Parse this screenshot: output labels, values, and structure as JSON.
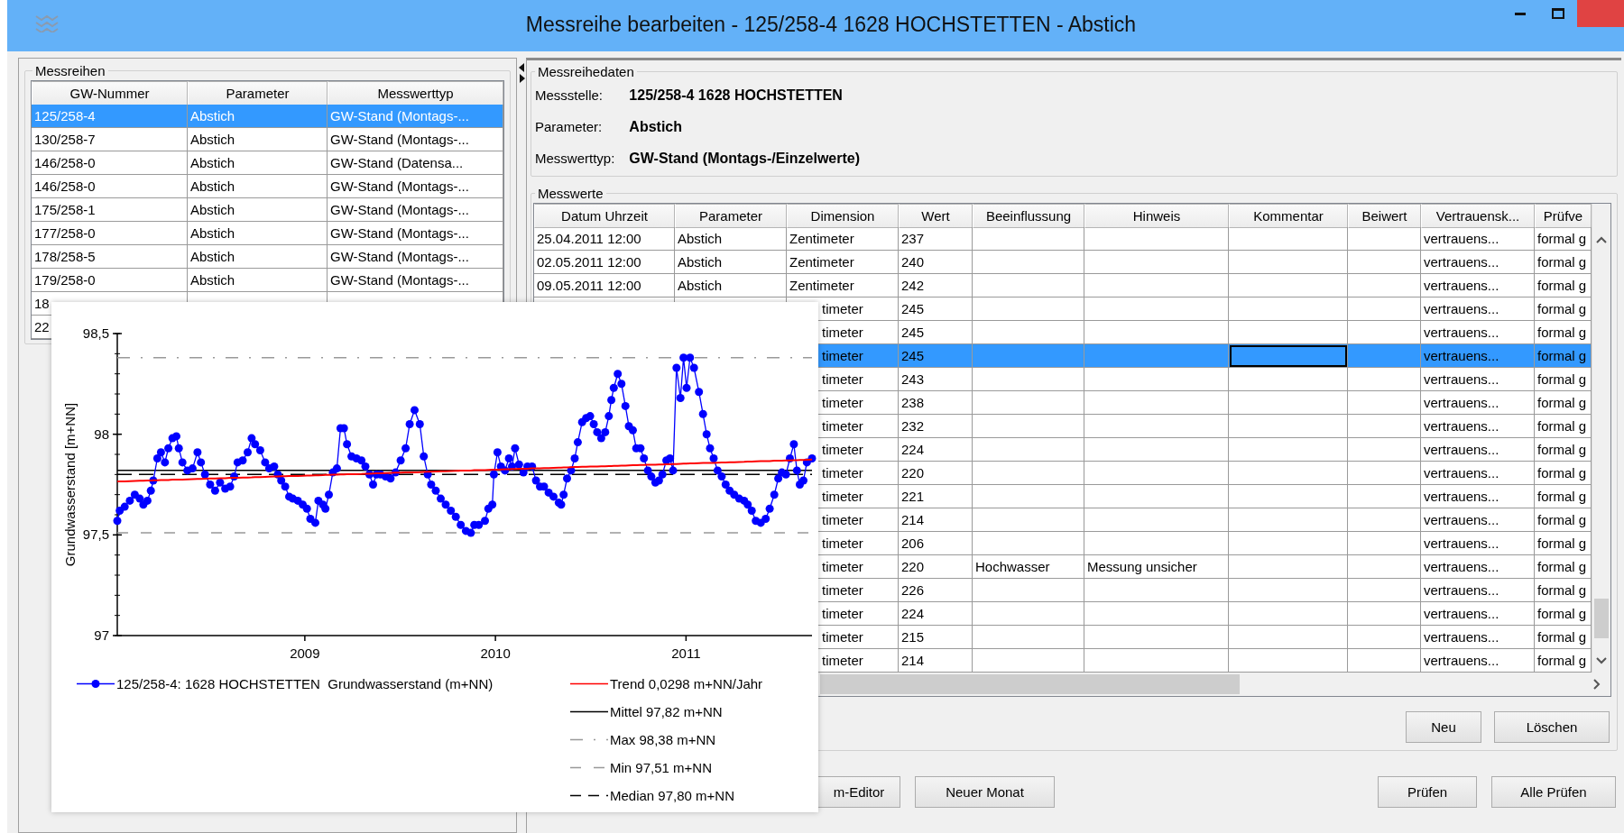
{
  "window": {
    "title": "Messreihe bearbeiten - 125/258-4 1628 HOCHSTETTEN - Abstich"
  },
  "messreihen": {
    "title": "Messreihen",
    "columns": [
      "GW-Nummer",
      "Parameter",
      "Messwerttyp"
    ],
    "rows": [
      {
        "gw_nummer": "125/258-4",
        "parameter": "Abstich",
        "messwerttyp": "GW-Stand (Montags-...",
        "selected": true
      },
      {
        "gw_nummer": "130/258-7",
        "parameter": "Abstich",
        "messwerttyp": "GW-Stand (Montags-...",
        "selected": false
      },
      {
        "gw_nummer": "146/258-0",
        "parameter": "Abstich",
        "messwerttyp": "GW-Stand (Datensa...",
        "selected": false
      },
      {
        "gw_nummer": "146/258-0",
        "parameter": "Abstich",
        "messwerttyp": "GW-Stand (Montags-...",
        "selected": false
      },
      {
        "gw_nummer": "175/258-1",
        "parameter": "Abstich",
        "messwerttyp": "GW-Stand (Montags-...",
        "selected": false
      },
      {
        "gw_nummer": "177/258-0",
        "parameter": "Abstich",
        "messwerttyp": "GW-Stand (Montags-...",
        "selected": false
      },
      {
        "gw_nummer": "178/258-5",
        "parameter": "Abstich",
        "messwerttyp": "GW-Stand (Montags-...",
        "selected": false
      },
      {
        "gw_nummer": "179/258-0",
        "parameter": "Abstich",
        "messwerttyp": "GW-Stand (Montags-...",
        "selected": false
      },
      {
        "gw_nummer": "18",
        "selected": false
      },
      {
        "gw_nummer": "22",
        "selected": false
      }
    ]
  },
  "messreihedaten": {
    "title": "Messreihedaten",
    "fields": [
      {
        "label": "Messstelle:",
        "value": "125/258-4 1628 HOCHSTETTEN"
      },
      {
        "label": "Parameter:",
        "value": "Abstich"
      },
      {
        "label": "Messwerttyp:",
        "value": "GW-Stand (Montags-/Einzelwerte)"
      }
    ]
  },
  "messwerte": {
    "title": "Messwerte",
    "columns": [
      "Datum Uhrzeit",
      "Parameter",
      "Dimension",
      "Wert",
      "Beeinflussung",
      "Hinweis",
      "Kommentar",
      "Beiwert",
      "Vertrauensk...",
      "Prüfve"
    ],
    "rows": [
      {
        "datum_uhrzeit": "25.04.2011 12:00",
        "parameter": "Abstich",
        "dimension": "Zentimeter",
        "wert": "237",
        "vertrauensk": "vertrauens...",
        "pruefve": "formal g",
        "selected": false,
        "focused": false
      },
      {
        "datum_uhrzeit": "02.05.2011 12:00",
        "parameter": "Abstich",
        "dimension": "Zentimeter",
        "wert": "240",
        "vertrauensk": "vertrauens...",
        "pruefve": "formal g",
        "selected": false,
        "focused": false
      },
      {
        "datum_uhrzeit": "09.05.2011 12:00",
        "parameter": "Abstich",
        "dimension": "Zentimeter",
        "wert": "242",
        "vertrauensk": "vertrauens...",
        "pruefve": "formal g",
        "selected": false,
        "focused": false
      },
      {
        "dimension": "timeter",
        "wert": "245",
        "vertrauensk": "vertrauens...",
        "pruefve": "formal g",
        "selected": false,
        "focused": false
      },
      {
        "dimension": "timeter",
        "wert": "245",
        "vertrauensk": "vertrauens...",
        "pruefve": "formal g",
        "selected": false,
        "focused": false
      },
      {
        "dimension": "timeter",
        "wert": "245",
        "vertrauensk": "vertrauens...",
        "pruefve": "formal g",
        "selected": true,
        "focused": true
      },
      {
        "dimension": "timeter",
        "wert": "243",
        "vertrauensk": "vertrauens...",
        "pruefve": "formal g",
        "selected": false,
        "focused": false
      },
      {
        "dimension": "timeter",
        "wert": "238",
        "vertrauensk": "vertrauens...",
        "pruefve": "formal g",
        "selected": false,
        "focused": false
      },
      {
        "dimension": "timeter",
        "wert": "232",
        "vertrauensk": "vertrauens...",
        "pruefve": "formal g",
        "selected": false,
        "focused": false
      },
      {
        "dimension": "timeter",
        "wert": "224",
        "vertrauensk": "vertrauens...",
        "pruefve": "formal g",
        "selected": false,
        "focused": false
      },
      {
        "dimension": "timeter",
        "wert": "220",
        "vertrauensk": "vertrauens...",
        "pruefve": "formal g",
        "selected": false,
        "focused": false
      },
      {
        "dimension": "timeter",
        "wert": "221",
        "vertrauensk": "vertrauens...",
        "pruefve": "formal g",
        "selected": false,
        "focused": false
      },
      {
        "dimension": "timeter",
        "wert": "214",
        "vertrauensk": "vertrauens...",
        "pruefve": "formal g",
        "selected": false,
        "focused": false
      },
      {
        "dimension": "timeter",
        "wert": "206",
        "vertrauensk": "vertrauens...",
        "pruefve": "formal g",
        "selected": false,
        "focused": false
      },
      {
        "dimension": "timeter",
        "wert": "220",
        "beeinflussung": "Hochwasser",
        "hinweis": "Messung unsicher",
        "vertrauensk": "vertrauens...",
        "pruefve": "formal g",
        "selected": false,
        "focused": false
      },
      {
        "dimension": "timeter",
        "wert": "226",
        "vertrauensk": "vertrauens...",
        "pruefve": "formal g",
        "selected": false,
        "focused": false
      },
      {
        "dimension": "timeter",
        "wert": "224",
        "vertrauensk": "vertrauens...",
        "pruefve": "formal g",
        "selected": false,
        "focused": false
      },
      {
        "dimension": "timeter",
        "wert": "215",
        "vertrauensk": "vertrauens...",
        "pruefve": "formal g",
        "selected": false,
        "focused": false
      },
      {
        "dimension": "timeter",
        "wert": "214",
        "vertrauensk": "vertrauens...",
        "pruefve": "formal g",
        "selected": false,
        "focused": false
      }
    ],
    "buttons": [
      "Neu",
      "Löschen"
    ]
  },
  "bottom_buttons": {
    "left": [
      "m-Editor",
      "Neuer Monat"
    ],
    "right": [
      "Prüfen",
      "Alle Prüfen"
    ]
  },
  "chart": {
    "chart_data": {
      "type": "line",
      "ylabel": "Grundwasserstand [m+NN]",
      "xlim": [
        2008.016,
        2011.661
      ],
      "ylim": [
        97,
        98.5
      ],
      "xticks": [
        2009,
        2010,
        2011
      ],
      "yticks": [
        97,
        {
          "value": 97.5,
          "label": "97,5"
        },
        98,
        {
          "value": 98.5,
          "label": "98,5"
        }
      ],
      "x": [
        2008.016,
        2008.029,
        2008.055,
        2008.082,
        2008.108,
        2008.134,
        2008.153,
        2008.174,
        2008.192,
        2008.205,
        2008.226,
        2008.245,
        2008.266,
        2008.284,
        2008.305,
        2008.326,
        2008.339,
        2008.358,
        2008.384,
        2008.411,
        2008.437,
        2008.455,
        2008.476,
        2008.503,
        2008.529,
        2008.555,
        2008.582,
        2008.608,
        2008.629,
        2008.647,
        2008.674,
        2008.7,
        2008.721,
        2008.739,
        2008.766,
        2008.792,
        2008.813,
        2008.839,
        2008.858,
        2008.876,
        2008.897,
        2008.918,
        2008.937,
        2008.963,
        2008.989,
        2009.011,
        2009.029,
        2009.055,
        2009.071,
        2009.095,
        2009.108,
        2009.126,
        2009.147,
        2009.168,
        2009.187,
        2009.205,
        2009.221,
        2009.245,
        2009.271,
        2009.297,
        2009.318,
        2009.339,
        2009.358,
        2009.376,
        2009.397,
        2009.424,
        2009.45,
        2009.476,
        2009.503,
        2009.529,
        2009.55,
        2009.576,
        2009.603,
        2009.624,
        2009.645,
        2009.663,
        2009.687,
        2009.713,
        2009.739,
        2009.766,
        2009.792,
        2009.818,
        2009.845,
        2009.871,
        2009.889,
        2009.913,
        2009.945,
        2009.963,
        2009.984,
        2009.992,
        2010.011,
        2010.029,
        2010.05,
        2010.071,
        2010.087,
        2010.103,
        2010.124,
        2010.147,
        2010.168,
        2010.192,
        2010.213,
        2010.234,
        2010.255,
        2010.279,
        2010.305,
        2010.332,
        2010.345,
        2010.358,
        2010.376,
        2010.397,
        2010.416,
        2010.432,
        2010.455,
        2010.476,
        2010.497,
        2010.516,
        2010.534,
        2010.555,
        2010.576,
        2010.595,
        2010.608,
        2010.621,
        2010.642,
        2010.661,
        2010.682,
        2010.7,
        2010.721,
        2010.739,
        2010.761,
        2010.779,
        2010.8,
        2010.818,
        2010.839,
        2010.858,
        2010.876,
        2010.897,
        2010.916,
        2010.932,
        2010.95,
        2010.971,
        2010.987,
        2011.003,
        2011.021,
        2011.042,
        2011.068,
        2011.089,
        2011.108,
        2011.126,
        2011.145,
        2011.166,
        2011.187,
        2011.208,
        2011.229,
        2011.253,
        2011.279,
        2011.305,
        2011.324,
        2011.345,
        2011.366,
        2011.392,
        2011.418,
        2011.439,
        2011.463,
        2011.484,
        2011.503,
        2011.524,
        2011.545,
        2011.566,
        2011.582,
        2011.597,
        2011.616,
        2011.634,
        2011.661
      ],
      "series": [
        {
          "name": "125/258-4: 1628 HOCHSTETTEN  Grundwasserstand (m+NN)",
          "color": "#0000ff",
          "marker": "circle",
          "values": [
            97.57,
            97.62,
            97.64,
            97.67,
            97.7,
            97.68,
            97.65,
            97.67,
            97.72,
            97.77,
            97.88,
            97.91,
            97.86,
            97.93,
            97.98,
            97.99,
            97.93,
            97.86,
            97.82,
            97.83,
            97.91,
            97.86,
            97.8,
            97.75,
            97.72,
            97.76,
            97.73,
            97.74,
            97.79,
            97.86,
            97.87,
            97.91,
            97.98,
            97.95,
            97.92,
            97.86,
            97.83,
            97.84,
            97.8,
            97.77,
            97.74,
            97.69,
            97.68,
            97.67,
            97.65,
            97.63,
            97.58,
            97.56,
            97.67,
            97.65,
            97.63,
            97.7,
            97.81,
            97.83,
            98.03,
            98.03,
            97.95,
            97.89,
            97.88,
            97.87,
            97.84,
            97.8,
            97.75,
            97.8,
            97.8,
            97.79,
            97.78,
            97.81,
            97.87,
            97.93,
            98.05,
            98.12,
            98.05,
            97.89,
            97.8,
            97.75,
            97.72,
            97.68,
            97.65,
            97.62,
            97.59,
            97.55,
            97.52,
            97.51,
            97.55,
            97.55,
            97.57,
            97.63,
            97.65,
            97.8,
            97.91,
            97.84,
            97.82,
            97.88,
            97.84,
            97.93,
            97.85,
            97.81,
            97.84,
            97.84,
            97.77,
            97.74,
            97.74,
            97.71,
            97.69,
            97.66,
            97.65,
            97.7,
            97.78,
            97.82,
            97.88,
            97.96,
            98.06,
            98.08,
            98.09,
            98.05,
            98.01,
            97.98,
            98.01,
            98.09,
            98.17,
            98.23,
            98.3,
            98.25,
            98.14,
            98.04,
            98.02,
            97.93,
            97.93,
            97.88,
            97.82,
            97.79,
            97.76,
            97.77,
            97.8,
            97.87,
            97.88,
            97.82,
            98.33,
            98.18,
            98.38,
            98.23,
            98.38,
            98.33,
            98.21,
            98.1,
            98.0,
            97.93,
            97.88,
            97.82,
            97.79,
            97.75,
            97.72,
            97.7,
            97.68,
            97.67,
            97.65,
            97.62,
            97.57,
            97.56,
            97.58,
            97.63,
            97.7,
            97.78,
            97.81,
            97.8,
            97.88,
            97.95,
            97.82,
            97.75,
            97.77,
            97.86,
            97.88
          ]
        },
        {
          "name": "Trend 0,0298 m+NN/Jahr",
          "color": "#ff0000",
          "marker": "none",
          "values": [
            97.765,
            97.765,
            97.766,
            97.767,
            97.768,
            97.769,
            97.769,
            97.77,
            97.77,
            97.771,
            97.771,
            97.772,
            97.772,
            97.773,
            97.774,
            97.774,
            97.775,
            97.775,
            97.776,
            97.777,
            97.778,
            97.778,
            97.779,
            97.78,
            97.78,
            97.781,
            97.782,
            97.783,
            97.783,
            97.784,
            97.785,
            97.785,
            97.786,
            97.787,
            97.787,
            97.788,
            97.789,
            97.79,
            97.79,
            97.791,
            97.791,
            97.792,
            97.792,
            97.793,
            97.794,
            97.795,
            97.795,
            97.796,
            97.796,
            97.797,
            97.798,
            97.798,
            97.799,
            97.799,
            97.8,
            97.8,
            97.801,
            97.802,
            97.802,
            97.803,
            97.804,
            97.804,
            97.805,
            97.806,
            97.806,
            97.807,
            97.808,
            97.809,
            97.809,
            97.81,
            97.811,
            97.811,
            97.812,
            97.813,
            97.814,
            97.814,
            97.815,
            97.816,
            97.816,
            97.817,
            97.818,
            97.819,
            97.819,
            97.82,
            97.821,
            97.822,
            97.822,
            97.823,
            97.824,
            97.824,
            97.824,
            97.825,
            97.826,
            97.826,
            97.827,
            97.827,
            97.828,
            97.829,
            97.829,
            97.83,
            97.83,
            97.831,
            97.832,
            97.832,
            97.833,
            97.834,
            97.834,
            97.835,
            97.835,
            97.836,
            97.837,
            97.837,
            97.838,
            97.838,
            97.839,
            97.84,
            97.84,
            97.841,
            97.841,
            97.842,
            97.842,
            97.843,
            97.843,
            97.844,
            97.844,
            97.845,
            97.846,
            97.846,
            97.847,
            97.847,
            97.848,
            97.849,
            97.849,
            97.85,
            97.85,
            97.851,
            97.851,
            97.852,
            97.852,
            97.853,
            97.854,
            97.854,
            97.855,
            97.855,
            97.856,
            97.857,
            97.857,
            97.858,
            97.858,
            97.859,
            97.86,
            97.86,
            97.861,
            97.861,
            97.862,
            97.863,
            97.864,
            97.864,
            97.865,
            97.866,
            97.866,
            97.867,
            97.868,
            97.868,
            97.869,
            97.87,
            97.87,
            97.871,
            97.871,
            97.872,
            97.872,
            97.873,
            97.874
          ]
        }
      ],
      "ref_lines": [
        {
          "axis": "y",
          "value": 97.82,
          "label": "Mittel 97,82 m+NN",
          "color": "#000000"
        },
        {
          "axis": "y",
          "value": 98.38,
          "label": "Max 98,38 m+NN",
          "color": "#999999"
        },
        {
          "axis": "y",
          "value": 97.51,
          "label": "Min 97,51 m+NN",
          "color": "#999999"
        },
        {
          "axis": "y",
          "value": 97.8,
          "label": "Median 97,80 m+NN",
          "color": "#000000"
        }
      ]
    }
  }
}
